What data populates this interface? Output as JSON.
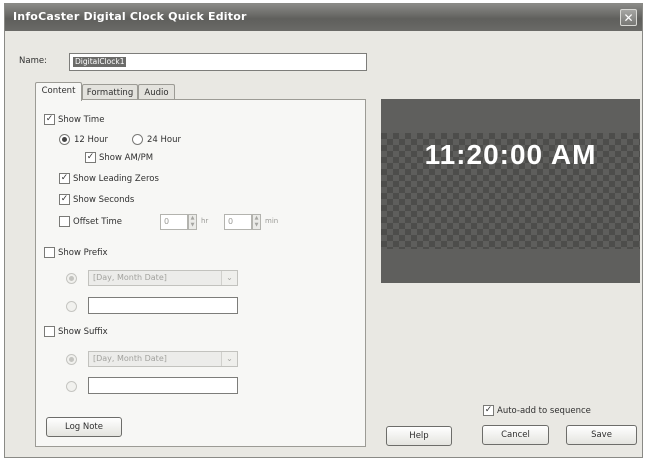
{
  "window": {
    "title": "InfoCaster Digital Clock Quick Editor",
    "close_glyph": "✕"
  },
  "name": {
    "label": "Name:",
    "value": "DigitalClock1"
  },
  "tabs": [
    {
      "label": "Content"
    },
    {
      "label": "Formatting"
    },
    {
      "label": "Audio"
    }
  ],
  "content": {
    "show_time": {
      "label": "Show Time",
      "checked": true
    },
    "hour_12": {
      "label": "12 Hour",
      "selected": true
    },
    "hour_24": {
      "label": "24 Hour",
      "selected": false
    },
    "show_ampm": {
      "label": "Show AM/PM",
      "checked": true
    },
    "leading_zeros": {
      "label": "Show Leading Zeros",
      "checked": true
    },
    "show_seconds": {
      "label": "Show Seconds",
      "checked": true
    },
    "offset_time": {
      "label": "Offset Time",
      "checked": false,
      "hours_value": "0",
      "hr_label": "hr",
      "minutes_value": "0",
      "min_label": "min"
    },
    "show_prefix": {
      "label": "Show Prefix",
      "checked": false,
      "format_value": "[Day, Month Date]",
      "text_value": ""
    },
    "show_suffix": {
      "label": "Show Suffix",
      "checked": false,
      "format_value": "[Day, Month Date]",
      "text_value": ""
    }
  },
  "preview": {
    "time_text": "11:20:00  AM"
  },
  "auto_add": {
    "label": "Auto-add to sequence",
    "checked": true
  },
  "buttons": {
    "log_note": "Log Note",
    "help": "Help",
    "cancel": "Cancel",
    "save": "Save"
  },
  "colors": {
    "title_bar": "#6a6a67",
    "dialog_bg": "#e9e8e3",
    "panel_bg": "#f7f7f5",
    "preview_bg": "#5f5f5d",
    "clock_text": "#ffffff"
  }
}
